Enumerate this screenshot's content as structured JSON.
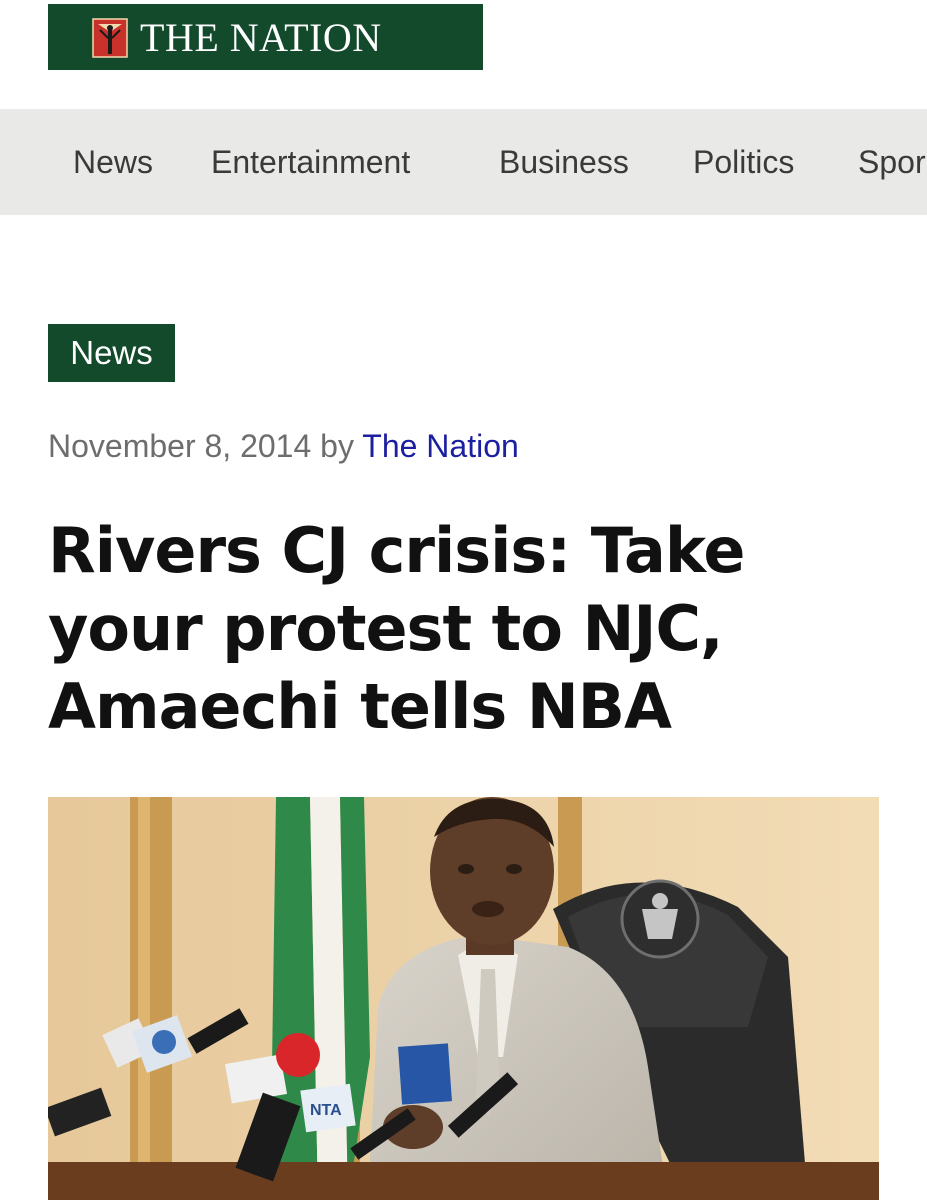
{
  "logo": {
    "text": "THE NATION",
    "bg_color": "#124a2b"
  },
  "nav": {
    "items": [
      {
        "label": "News"
      },
      {
        "label": "Entertainment"
      },
      {
        "label": "Business"
      },
      {
        "label": "Politics"
      },
      {
        "label": "Spor"
      }
    ]
  },
  "article": {
    "category": "News",
    "date": "November 8, 2014",
    "by": "by",
    "author": "The Nation",
    "headline": "Rivers CJ crisis: Take your protest to NJC, Amaechi tells NBA",
    "author_color": "#1c1fa0"
  },
  "photo": {
    "mic_labels": [
      "NTA"
    ]
  }
}
